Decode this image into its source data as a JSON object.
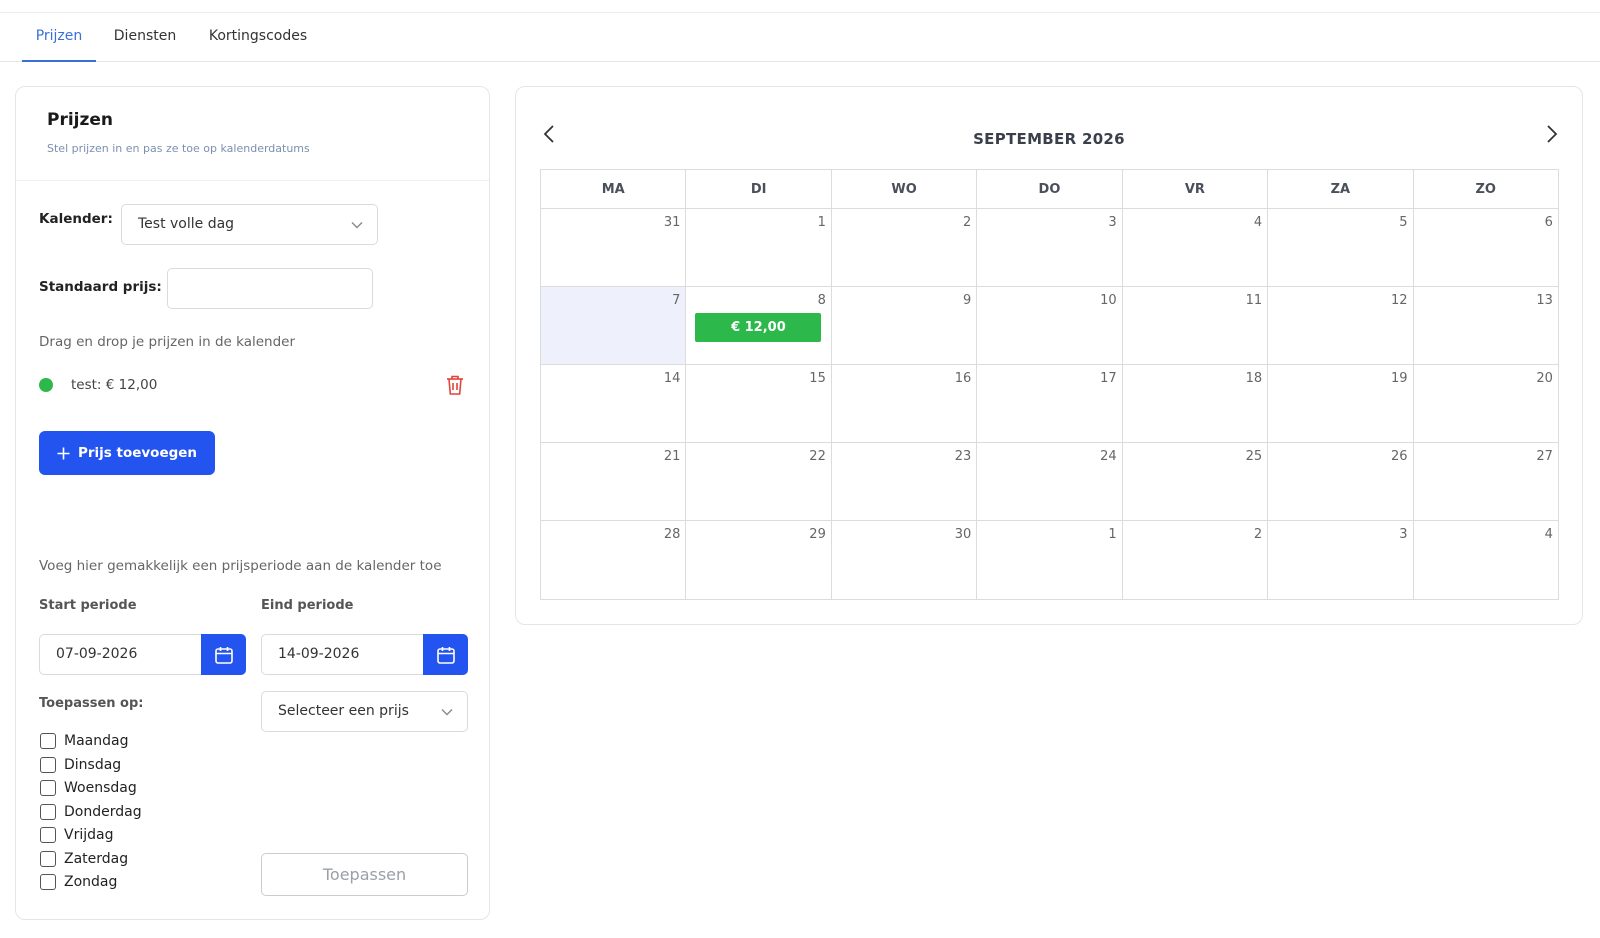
{
  "tabs": [
    {
      "label": "Prijzen",
      "active": true
    },
    {
      "label": "Diensten",
      "active": false
    },
    {
      "label": "Kortingscodes",
      "active": false
    }
  ],
  "left_panel": {
    "title": "Prijzen",
    "subtitle": "Stel prijzen in en pas ze toe op kalenderdatums",
    "calendar_label": "Kalender:",
    "calendar_value": "Test volle dag",
    "default_price_label": "Standaard prijs:",
    "default_price_value": "",
    "drag_hint": "Drag en drop je prijzen in de kalender",
    "prices": [
      {
        "label": "test: € 12,00",
        "color": "#2db84b"
      }
    ],
    "add_price_button": "Prijs toevoegen",
    "period_hint": "Voeg hier gemakkelijk een prijsperiode aan de kalender toe",
    "start_label": "Start periode",
    "start_value": "07-09-2026",
    "end_label": "Eind periode",
    "end_value": "14-09-2026",
    "apply_on_label": "Toepassen op:",
    "price_select_placeholder": "Selecteer een prijs",
    "weekdays": [
      "Maandag",
      "Dinsdag",
      "Woensdag",
      "Donderdag",
      "Vrijdag",
      "Zaterdag",
      "Zondag"
    ],
    "apply_button": "Toepassen"
  },
  "calendar": {
    "month_title": "SEPTEMBER 2026",
    "day_headers": [
      "MA",
      "DI",
      "WO",
      "DO",
      "VR",
      "ZA",
      "ZO"
    ],
    "weeks": [
      [
        "31",
        "1",
        "2",
        "3",
        "4",
        "5",
        "6"
      ],
      [
        "7",
        "8",
        "9",
        "10",
        "11",
        "12",
        "13"
      ],
      [
        "14",
        "15",
        "16",
        "17",
        "18",
        "19",
        "20"
      ],
      [
        "21",
        "22",
        "23",
        "24",
        "25",
        "26",
        "27"
      ],
      [
        "28",
        "29",
        "30",
        "1",
        "2",
        "3",
        "4"
      ]
    ],
    "price_chip": "€ 12,00",
    "highlighted_day": "7",
    "chip_day": "8"
  },
  "colors": {
    "accent": "#2454f0",
    "tab_active": "#3a6fd8",
    "price_green": "#2db84b",
    "delete_red": "#e0443a"
  }
}
